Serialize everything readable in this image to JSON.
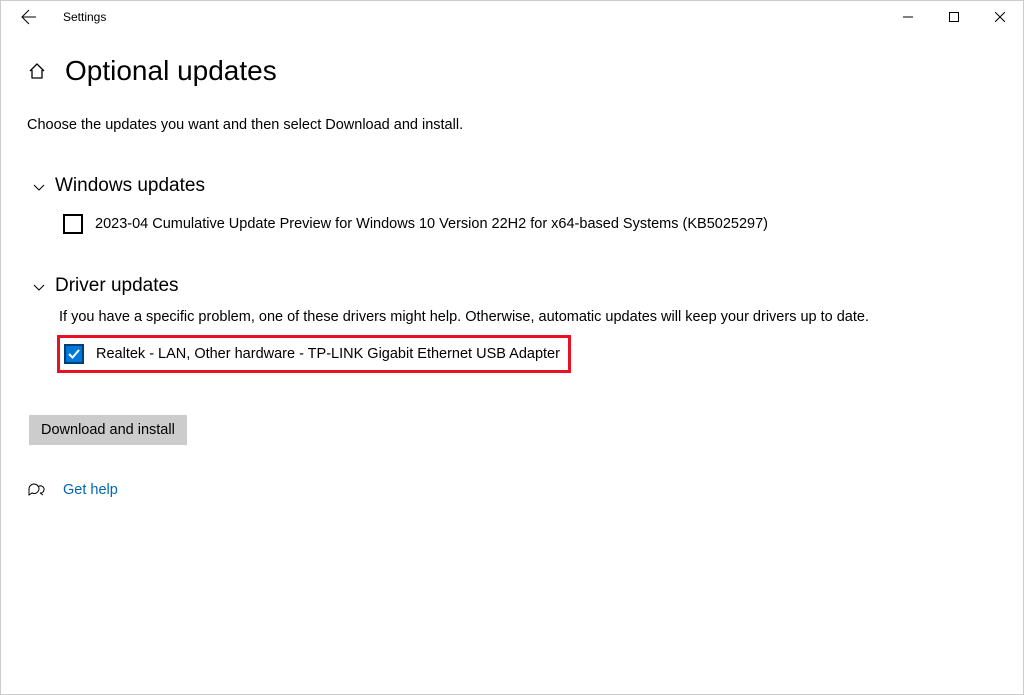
{
  "titlebar": {
    "app_name": "Settings"
  },
  "header": {
    "title": "Optional updates"
  },
  "description": "Choose the updates you want and then select Download and install.",
  "sections": {
    "windows": {
      "title": "Windows updates",
      "items": [
        {
          "label": "2023-04 Cumulative Update Preview for Windows 10 Version 22H2 for x64-based Systems (KB5025297)",
          "checked": false
        }
      ]
    },
    "driver": {
      "title": "Driver updates",
      "subtitle": "If you have a specific problem, one of these drivers might help. Otherwise, automatic updates will keep your drivers up to date.",
      "items": [
        {
          "label": "Realtek - LAN, Other hardware - TP-LINK Gigabit Ethernet USB Adapter",
          "checked": true
        }
      ]
    }
  },
  "actions": {
    "download_install": "Download and install"
  },
  "help": {
    "label": "Get help"
  }
}
